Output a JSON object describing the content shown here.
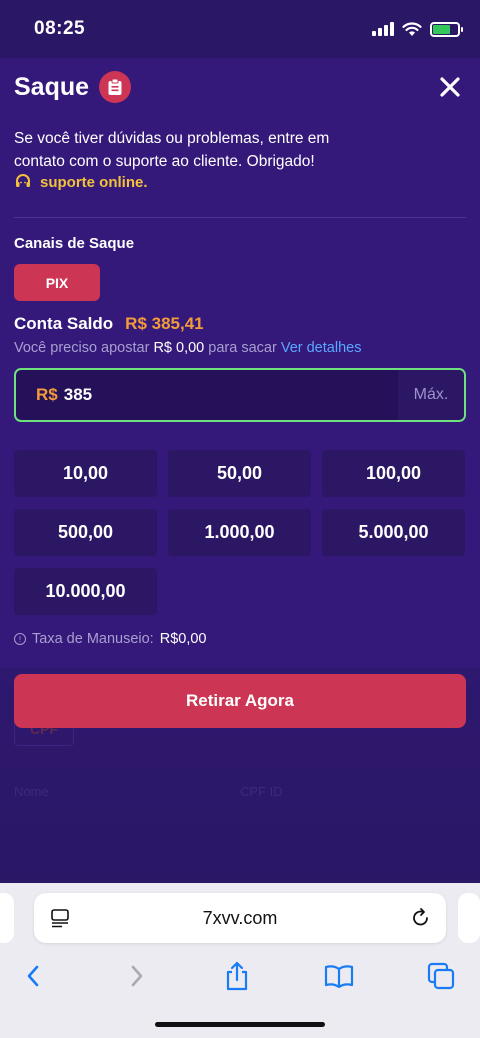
{
  "status": {
    "time": "08:25"
  },
  "sheet": {
    "title": "Saque",
    "notice": "Se você tiver dúvidas ou problemas, entre em contato com o suporte ao cliente. Obrigado!",
    "support_link": "suporte online.",
    "channels_label": "Canais de Saque",
    "channel_button": "PIX",
    "balance_label": "Conta Saldo",
    "balance_value": "R$ 385,41",
    "bet_prefix": "Você preciso apostar",
    "bet_amount": "R$ 0,00",
    "bet_suffix": "para sacar",
    "details_link": "Ver detalhes",
    "amount_currency": "R$",
    "amount_value": "385",
    "max_label": "Máx.",
    "presets": [
      "10,00",
      "50,00",
      "100,00",
      "500,00",
      "1.000,00",
      "5.000,00",
      "10.000,00"
    ],
    "fee_label": "Taxa de Manuseio:",
    "fee_value": "R$0,00",
    "withdraw_button": "Retirar Agora"
  },
  "background": {
    "cpf_tab": "CPF",
    "name_label": "Nome",
    "cpf_id_label": "CPF ID"
  },
  "browser": {
    "url": "7xvv.com"
  },
  "colors": {
    "background": "#2a1766",
    "sheet": "#34197a",
    "accent": "#cc3553",
    "balance": "#f39b3b",
    "support": "#f2c23b",
    "input_border": "#6fe07d",
    "link": "#5aa7ff"
  }
}
